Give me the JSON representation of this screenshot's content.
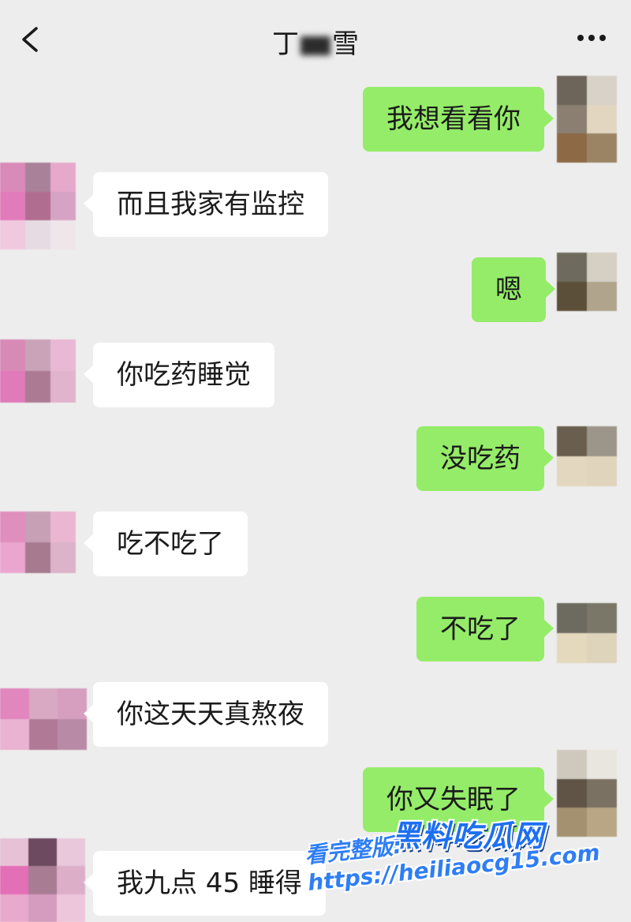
{
  "header": {
    "title_start": "丁",
    "title_end": "雪"
  },
  "messages": [
    {
      "side": "out",
      "text": "我想看看你"
    },
    {
      "side": "in",
      "text": "而且我家有监控"
    },
    {
      "side": "out",
      "text": "嗯"
    },
    {
      "side": "in",
      "text": "你吃药睡觉"
    },
    {
      "side": "out",
      "text": "没吃药"
    },
    {
      "side": "in",
      "text": "吃不吃了"
    },
    {
      "side": "out",
      "text": "不吃了"
    },
    {
      "side": "in",
      "text": "你这天天真熬夜"
    },
    {
      "side": "out",
      "text": "你又失眠了"
    },
    {
      "side": "in",
      "text": "我九点 45 睡得"
    }
  ],
  "watermark": {
    "logo": "黑料吃瓜网",
    "url": "看完整版: https://heiliaocg15.com"
  },
  "colors": {
    "background": "#ededed",
    "bubble_out": "#95ec69",
    "bubble_in": "#ffffff",
    "watermark": "#1d6ff2"
  },
  "icons": [
    "back-arrow-icon",
    "more-dots-icon"
  ]
}
